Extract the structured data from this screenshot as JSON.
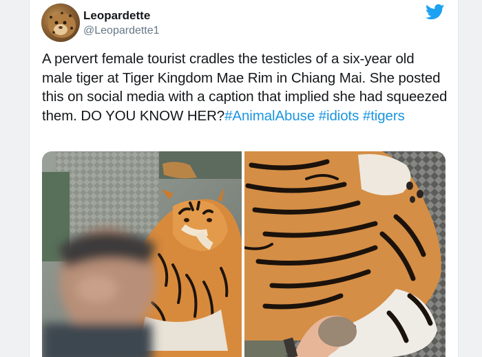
{
  "user": {
    "display_name": "Leopardette",
    "handle": "@Leopardette1",
    "avatar_icon": "leopard-avatar-icon"
  },
  "brand": {
    "icon": "twitter-bird-icon",
    "color": "#1da1f2"
  },
  "tweet": {
    "text_before": "A pervert female tourist cradles the testicles of a six-year old male tiger at Tiger Kingdom Mae Rim in Chiang Mai. She posted this on social media with a caption that implied she had squeezed them. DO YOU KNOW HER?",
    "hashtags": [
      "#AnimalAbuse",
      "#idiots",
      "#tigers"
    ],
    "link_color": "#1b95e0"
  },
  "media": {
    "count": 2,
    "items": [
      "tourist-with-tiger-photo",
      "tiger-closeup-photo"
    ]
  }
}
